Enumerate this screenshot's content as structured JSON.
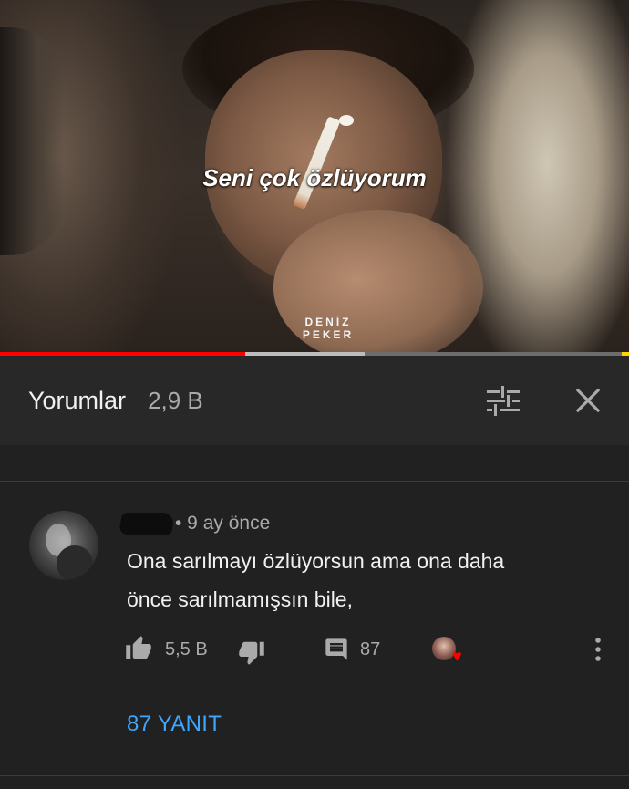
{
  "video": {
    "caption": "Seni çok özlüyorum",
    "watermark_line1": "DENİZ",
    "watermark_line2": "PEKER",
    "progress_played_fraction": 0.39,
    "progress_buffered_fraction": 0.58
  },
  "comments_panel": {
    "title": "Yorumlar",
    "count": "2,9 B",
    "sort_icon": "sort-filter-icon",
    "close_icon": "close-icon"
  },
  "comment": {
    "author_redacted": true,
    "time_meta": "• 9 ay önce",
    "text_line1": "Ona sarılmayı özlüyorsun ama ona daha",
    "text_line2": "önce sarılmamışsın bile,",
    "likes": "5,5 B",
    "replies_count": "87",
    "replies_link": "87 YANIT",
    "heart_icon": "creator-heart-icon"
  },
  "colors": {
    "background": "#212121",
    "header_bg": "#282828",
    "accent_blue": "#3ea6ff",
    "progress_red": "#ff0000",
    "secondary_text": "#aaaaaa"
  }
}
